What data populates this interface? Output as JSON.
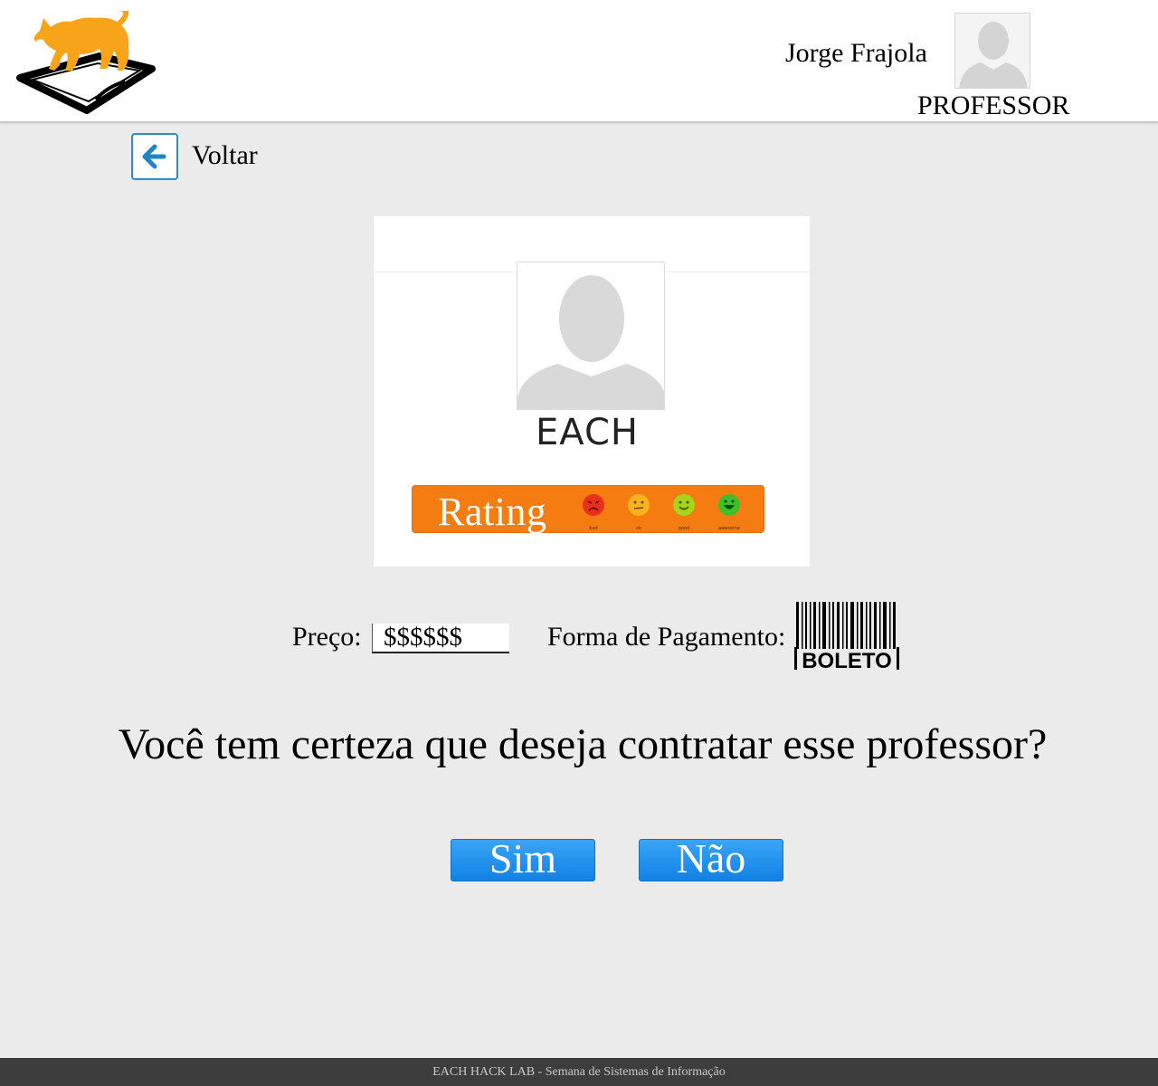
{
  "header": {
    "user_name": "Jorge Frajola",
    "user_role": "PROFESSOR",
    "logo_icon": "cat-on-book-logo",
    "avatar_icon": "user-silhouette-icon"
  },
  "nav": {
    "back_label": "Voltar",
    "back_icon": "arrow-left-icon"
  },
  "teacher_card": {
    "name": "EACH",
    "rating_label": "Rating",
    "rating_faces": [
      {
        "icon": "angry-face-icon",
        "color": "#e8301c",
        "caption": "bad"
      },
      {
        "icon": "neutral-face-icon",
        "color": "#f7b21c",
        "caption": "ok"
      },
      {
        "icon": "happy-face-icon",
        "color": "#a6d51a",
        "caption": "good"
      },
      {
        "icon": "very-happy-face-icon",
        "color": "#3fbf2a",
        "caption": "awesome"
      }
    ]
  },
  "payment": {
    "price_label": "Preço:",
    "price_value": "$$$$$$",
    "method_label": "Forma de Pagamento:",
    "method_icon": "boleto-barcode-icon",
    "method_text": "BOLETO"
  },
  "confirm": {
    "question": "Você tem certeza que deseja contratar esse professor?",
    "yes_label": "Sim",
    "no_label": "Não"
  },
  "footer": {
    "text": "EACH HACK LAB - Semana de Sistemas de Informação"
  },
  "colors": {
    "accent_blue": "#1a8ce8",
    "rating_orange": "#f47c10",
    "background": "#ebebeb",
    "footer_bg": "#3d3d3d"
  }
}
